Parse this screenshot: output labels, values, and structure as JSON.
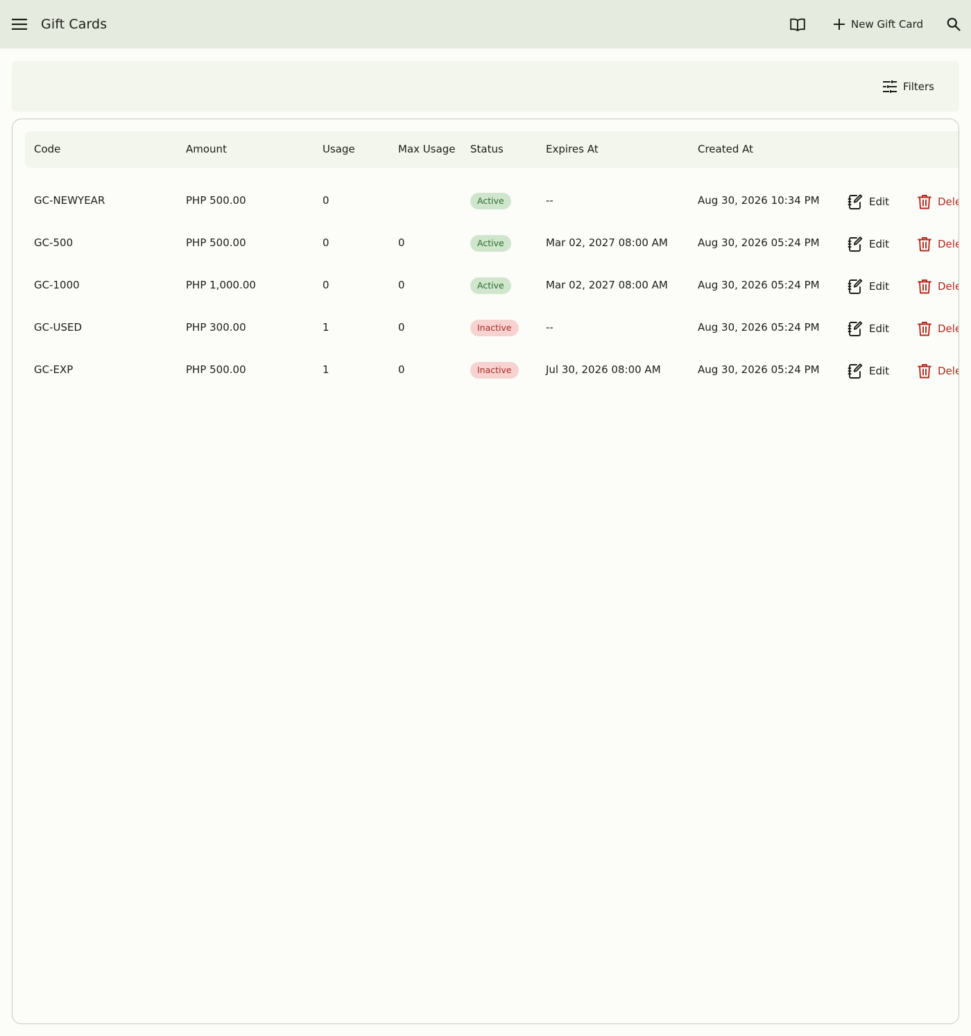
{
  "app_bar": {
    "title": "Gift Cards",
    "new_button_label": "New Gift Card"
  },
  "filter_bar": {
    "filters_label": "Filters"
  },
  "table": {
    "columns": [
      "Code",
      "Amount",
      "Usage",
      "Max Usage",
      "Status",
      "Expires At",
      "Created At"
    ],
    "rows": [
      {
        "code": "GC-NEWYEAR",
        "amount": "PHP 500.00",
        "usage": "0",
        "max_usage": "",
        "status": "Active",
        "expires_at": "--",
        "created_at": "Aug 30, 2026 10:34 PM",
        "edit": "Edit",
        "delete": "Dele"
      },
      {
        "code": "GC-500",
        "amount": "PHP 500.00",
        "usage": "0",
        "max_usage": "0",
        "status": "Active",
        "expires_at": "Mar 02, 2027 08:00 AM",
        "created_at": "Aug 30, 2026 05:24 PM",
        "edit": "Edit",
        "delete": "Dele"
      },
      {
        "code": "GC-1000",
        "amount": "PHP 1,000.00",
        "usage": "0",
        "max_usage": "0",
        "status": "Active",
        "expires_at": "Mar 02, 2027 08:00 AM",
        "created_at": "Aug 30, 2026 05:24 PM",
        "edit": "Edit",
        "delete": "Dele"
      },
      {
        "code": "GC-USED",
        "amount": "PHP 300.00",
        "usage": "1",
        "max_usage": "0",
        "status": "Inactive",
        "expires_at": "--",
        "created_at": "Aug 30, 2026 05:24 PM",
        "edit": "Edit",
        "delete": "Dele"
      },
      {
        "code": "GC-EXP",
        "amount": "PHP 500.00",
        "usage": "1",
        "max_usage": "0",
        "status": "Inactive",
        "expires_at": "Jul 30, 2026 08:00 AM",
        "created_at": "Aug 30, 2026 05:24 PM",
        "edit": "Edit",
        "delete": "Dele"
      }
    ]
  },
  "icons": {
    "menu": "menu-icon",
    "docs": "book-icon",
    "add": "plus-icon",
    "search": "search-icon",
    "filters": "tune-icon",
    "edit": "edit-note-icon",
    "delete": "trash-icon"
  },
  "colors": {
    "app_bar_bg": "#e6ebdf",
    "surface": "#fcfdf8",
    "active_badge_bg": "#cfe6cd",
    "active_badge_text": "#2d6a2e",
    "inactive_badge_bg": "#f6d3d1",
    "inactive_badge_text": "#b3261e",
    "danger": "#b3261e"
  }
}
